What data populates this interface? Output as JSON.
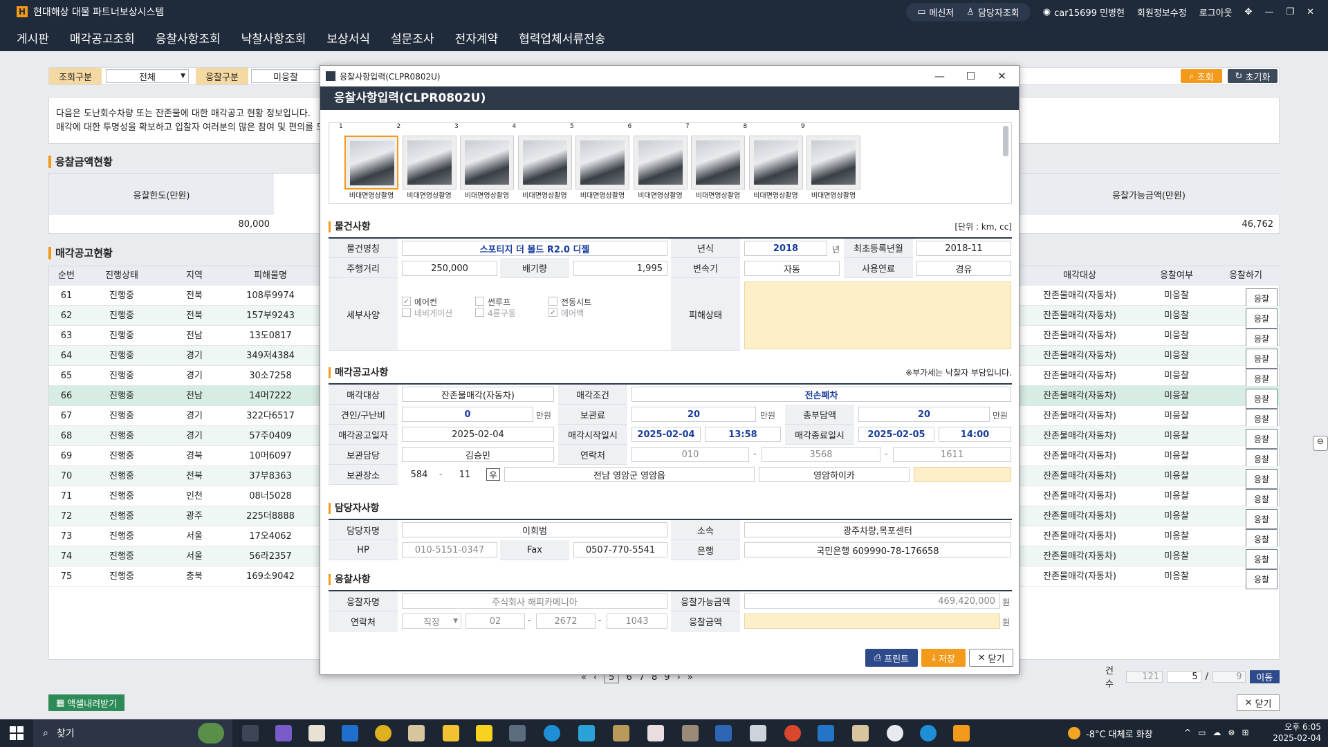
{
  "app": {
    "title": "현대해상 대물 파트너보상시스템",
    "logo_letter": "H",
    "user": "car15699 민병현",
    "links": [
      "메신저",
      "담당자조회",
      "회원정보수정",
      "로그아웃"
    ]
  },
  "menu": [
    "게시판",
    "매각공고조회",
    "응찰사항조회",
    "낙찰사항조회",
    "보상서식",
    "설문조사",
    "전자계약",
    "협력업체서류전송"
  ],
  "search": {
    "label1": "조회구분",
    "value1": "전체",
    "label2": "응찰구분",
    "value2": "미응찰",
    "btn_search": "조회",
    "btn_reset": "초기화"
  },
  "notice": {
    "line1": "다음은 도난회수차량 또는 잔존물에 대한 매각공고 현황 정보입니다.",
    "line2": "매각에 대한 투명성을 확보하고 입찰자 여러분의 많은 참여 및 편의를 도모"
  },
  "bid_amount": {
    "section": "응찰금액현황",
    "limit_label": "응찰한도(만원)",
    "limit_value": "80,000",
    "available_label": "응찰가능금액(만원)",
    "available_value": "46,762"
  },
  "list": {
    "section": "매각공고현황",
    "headers": [
      "순번",
      "진행상태",
      "지역",
      "피해물명",
      "매각대상",
      "응찰여부",
      "응찰하기"
    ],
    "rows": [
      {
        "no": "61",
        "status": "진행중",
        "region": "전북",
        "plate": "108루9974",
        "target": "잔존물매각(자동차)",
        "bid": "미응찰",
        "btn": "응찰"
      },
      {
        "no": "62",
        "status": "진행중",
        "region": "전북",
        "plate": "157부9243",
        "target": "잔존물매각(자동차)",
        "bid": "미응찰",
        "btn": "응찰"
      },
      {
        "no": "63",
        "status": "진행중",
        "region": "전남",
        "plate": "13도0817",
        "target": "잔존물매각(자동차)",
        "bid": "미응찰",
        "btn": "응찰"
      },
      {
        "no": "64",
        "status": "진행중",
        "region": "경기",
        "plate": "349저4384",
        "target": "잔존물매각(자동차)",
        "bid": "미응찰",
        "btn": "응찰"
      },
      {
        "no": "65",
        "status": "진행중",
        "region": "경기",
        "plate": "30소7258",
        "target": "잔존물매각(자동차)",
        "bid": "미응찰",
        "btn": "응찰"
      },
      {
        "no": "66",
        "status": "진행중",
        "region": "전남",
        "plate": "14머7222",
        "target": "잔존물매각(자동차)",
        "bid": "미응찰",
        "btn": "응찰"
      },
      {
        "no": "67",
        "status": "진행중",
        "region": "경기",
        "plate": "322다6517",
        "target": "잔존물매각(자동차)",
        "bid": "미응찰",
        "btn": "응찰"
      },
      {
        "no": "68",
        "status": "진행중",
        "region": "경기",
        "plate": "57주0409",
        "target": "잔존물매각(자동차)",
        "bid": "미응찰",
        "btn": "응찰"
      },
      {
        "no": "69",
        "status": "진행중",
        "region": "경북",
        "plate": "10머6097",
        "target": "잔존물매각(자동차)",
        "bid": "미응찰",
        "btn": "응찰"
      },
      {
        "no": "70",
        "status": "진행중",
        "region": "전북",
        "plate": "37부8363",
        "target": "잔존물매각(자동차)",
        "bid": "미응찰",
        "btn": "응찰"
      },
      {
        "no": "71",
        "status": "진행중",
        "region": "인천",
        "plate": "08너5028",
        "target": "잔존물매각(자동차)",
        "bid": "미응찰",
        "btn": "응찰"
      },
      {
        "no": "72",
        "status": "진행중",
        "region": "광주",
        "plate": "225더8888",
        "target": "잔존물매각(자동차)",
        "bid": "미응찰",
        "btn": "응찰"
      },
      {
        "no": "73",
        "status": "진행중",
        "region": "서울",
        "plate": "17오4062",
        "target": "잔존물매각(자동차)",
        "bid": "미응찰",
        "btn": "응찰"
      },
      {
        "no": "74",
        "status": "진행중",
        "region": "서울",
        "plate": "56라2357",
        "target": "잔존물매각(자동차)",
        "bid": "미응찰",
        "btn": "응찰"
      },
      {
        "no": "75",
        "status": "진행중",
        "region": "충북",
        "plate": "169소9042",
        "target": "잔존물매각(자동차)",
        "bid": "미응찰",
        "btn": "응찰"
      }
    ],
    "pages": [
      "5",
      "6",
      "7",
      "8",
      "9"
    ],
    "count_label": "건수",
    "count": "121",
    "page_current": "5",
    "page_sep": "/",
    "page_total": "9",
    "go": "이동",
    "excel": "액셀내려받기",
    "close": "닫기"
  },
  "modal": {
    "window_title": "응찰사항입력(CLPR0802U)",
    "header": "응찰사항입력(CLPR0802U)",
    "photos": [
      {
        "n": "1",
        "label": "비대면영상촬영"
      },
      {
        "n": "2",
        "label": "비대면영상촬영"
      },
      {
        "n": "3",
        "label": "비대면영상촬영"
      },
      {
        "n": "4",
        "label": "비대면영상촬영"
      },
      {
        "n": "5",
        "label": "비대면영상촬영"
      },
      {
        "n": "6",
        "label": "비대면영상촬영"
      },
      {
        "n": "7",
        "label": "비대면영상촬영"
      },
      {
        "n": "8",
        "label": "비대면영상촬영"
      },
      {
        "n": "9",
        "label": "비대면영상촬영"
      }
    ],
    "item": {
      "section": "물건사항",
      "unit_note": "[단위 : km, cc]",
      "name_label": "물건명칭",
      "name": "스포티지 더 볼드 R2.0 디젤",
      "year_label": "년식",
      "year": "2018",
      "year_unit": "년",
      "reg_label": "최초등록년월",
      "reg": "2018-11",
      "mileage_label": "주행거리",
      "mileage": "250,000",
      "disp_label": "배기량",
      "disp": "1,995",
      "trans_label": "변속기",
      "trans": "자동",
      "fuel_label": "사용연료",
      "fuel": "경유",
      "detail_label": "세부사양",
      "options": [
        {
          "label": "에어컨",
          "checked": true,
          "disabled": false
        },
        {
          "label": "썬루프",
          "checked": false,
          "disabled": false
        },
        {
          "label": "전동시트",
          "checked": false,
          "disabled": false
        },
        {
          "label": "네비게이션",
          "checked": false,
          "disabled": true
        },
        {
          "label": "4륜구동",
          "checked": false,
          "disabled": true
        },
        {
          "label": "에어백",
          "checked": true,
          "disabled": true
        }
      ],
      "damage_label": "피해상태",
      "damage": ""
    },
    "sale": {
      "section": "매각공고사항",
      "vat_note": "※부가세는 낙찰자 부담입니다.",
      "target_label": "매각대상",
      "target": "잔존물매각(자동차)",
      "cond_label": "매각조건",
      "cond": "전손폐차",
      "tow_label": "견인/구난비",
      "tow": "0",
      "unit_man": "만원",
      "storage_fee_label": "보관료",
      "storage_fee": "20",
      "total_label": "총부담액",
      "total": "20",
      "notice_date_label": "매각공고일자",
      "notice_date": "2025-02-04",
      "start_label": "매각시작일시",
      "start_date": "2025-02-04",
      "start_time": "13:58",
      "end_label": "매각종료일시",
      "end_date": "2025-02-05",
      "end_time": "14:00",
      "keeper_label": "보관담당",
      "keeper": "김승민",
      "contact_label": "연락처",
      "tel1": "010",
      "tel2": "3568",
      "tel3": "1611",
      "place_label": "보관장소",
      "zip1": "584",
      "zip2": "11",
      "zip_btn": "우",
      "addr1": "전남 영암군 영암읍",
      "addr2": "영암하이카",
      "dash": "-"
    },
    "manager": {
      "section": "담당자사항",
      "name_label": "담당자명",
      "name": "이희범",
      "org_label": "소속",
      "org": "광주차량,목포센터",
      "hp_label": "HP",
      "hp": "010-5151-0347",
      "fax_label": "Fax",
      "fax": "0507-770-5541",
      "bank_label": "은행",
      "bank": "국민은행 609990-78-176658"
    },
    "bid": {
      "section": "응찰사항",
      "bidder_label": "응찰자명",
      "bidder": "주식회사 해피카메니아",
      "avail_label": "응찰가능금액",
      "avail": "469,420,000",
      "won": "원",
      "contact_label": "연락처",
      "phone_type": "직장",
      "p1": "02",
      "p2": "2672",
      "p3": "1043",
      "amount_label": "응찰금액",
      "amount": ""
    },
    "buttons": {
      "print": "프린트",
      "save": "저장",
      "close": "닫기"
    }
  },
  "taskbar": {
    "search": "찾기",
    "weather": "-8°C 대체로 화창",
    "time": "오후 6:05",
    "date": "2025-02-04"
  }
}
